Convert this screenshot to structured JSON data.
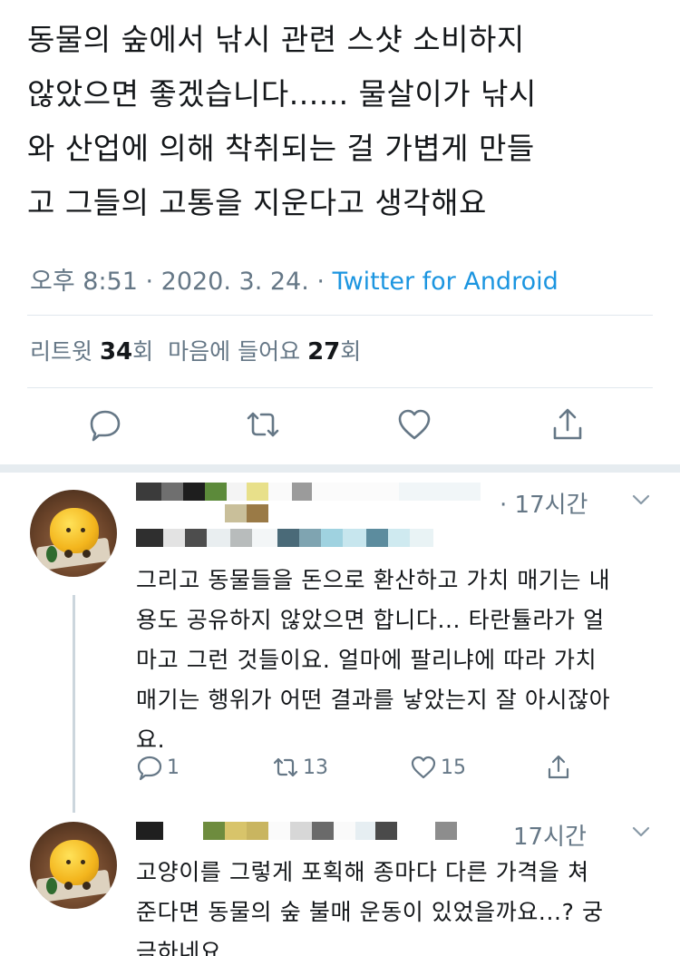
{
  "tweet": {
    "text_lines": [
      "동물의 숲에서 낚시 관련 스샷 소비하지",
      "않았으면 좋겠습니다...... 물살이가 낚시",
      "와 산업에 의해 착취되는 걸 가볍게 만들",
      "고 그들의 고통을 지운다고 생각해요"
    ],
    "timestamp": "오후 8:51 · 2020. 3. 24. · ",
    "client": "Twitter for Android",
    "retweets_label": "리트윗 ",
    "retweets_count": "34",
    "retweets_unit": "회",
    "likes_label": "마음에 들어요 ",
    "likes_count": "27",
    "likes_unit": "회"
  },
  "actions": {
    "reply_icon": "reply-icon",
    "retweet_icon": "retweet-icon",
    "like_icon": "heart-icon",
    "share_icon": "share-icon"
  },
  "replies": [
    {
      "time": "· 17시간",
      "text_lines": [
        "그리고 동물들을 돈으로 환산하고 가치 매기는 내",
        "용도 공유하지 않았으면 합니다... 타란튤라가 얼",
        "마고 그런 것들이요. 얼마에 팔리냐에 따라 가치",
        "매기는 행위가 어떤 결과를 낳았는지 잘 아시잖아",
        "요."
      ],
      "reply_count": "1",
      "retweet_count": "13",
      "like_count": "15"
    },
    {
      "time": "17시간",
      "text_lines": [
        "고양이를 그렇게 포획해 종마다 다른 가격을 쳐",
        "준다면 동물의 숲 불매 운동이 있었을까요...? 궁",
        "금하네요......."
      ]
    }
  ],
  "colors": {
    "text": "#14171a",
    "secondary": "#657786",
    "link": "#1b95e0",
    "divider": "#e1e8ed"
  }
}
